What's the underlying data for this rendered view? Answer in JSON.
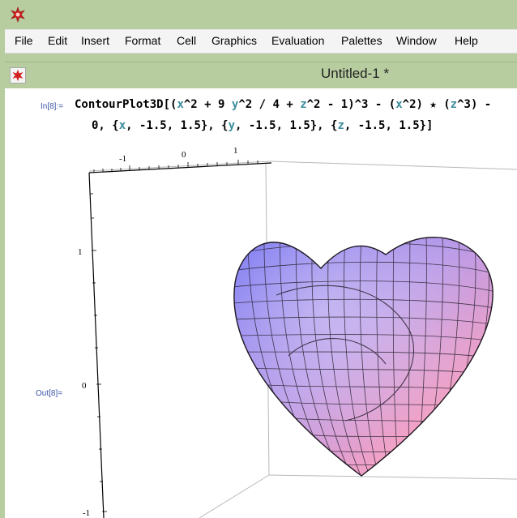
{
  "app": {
    "icon": "mathematica-star-icon"
  },
  "menu": [
    "File",
    "Edit",
    "Insert",
    "Format",
    "Cell",
    "Graphics",
    "Evaluation",
    "Palettes",
    "Window",
    "Help"
  ],
  "document": {
    "title": "Untitled-1 *",
    "icon": "mathematica-star-icon"
  },
  "cells": {
    "input_label": "In[8]:=",
    "output_label": "Out[8]=",
    "line1": {
      "fn": "ContourPlot3D",
      "t1": "[(",
      "x": "x",
      "t2": "^2 + 9 ",
      "y": "y",
      "t3": "^2 / 4 + ",
      "z": "z",
      "t4": "^2 - 1)^3 - (",
      "x2": "x",
      "t5": "^2) ",
      "star": "★",
      "t6": " (",
      "z2": "z",
      "t7": "^3) -"
    },
    "line2": {
      "t1": "0, {",
      "x": "x",
      "t2": ", -1.5, 1.5}, {",
      "y": "y",
      "t3": ", -1.5, 1.5}, {",
      "z": "z",
      "t4": ", -1.5, 1.5}]"
    }
  },
  "plot": {
    "top_axis_ticks": [
      "-1",
      "0",
      "1"
    ],
    "left_axis_ticks": [
      "1",
      "0",
      "-1"
    ]
  },
  "colors": {
    "chrome": "#b7cda0",
    "var": "#3a8c9a",
    "label": "#3b55a5"
  }
}
